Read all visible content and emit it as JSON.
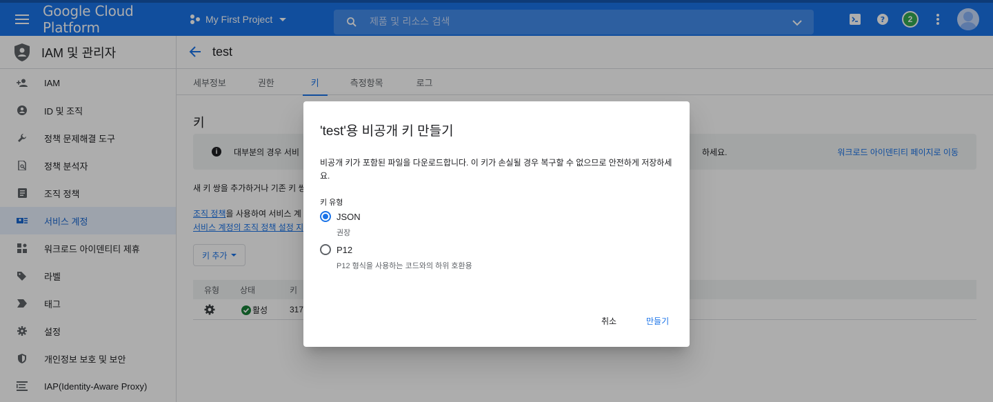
{
  "topbar": {
    "brand": "Google Cloud Platform",
    "project": "My First Project",
    "search_placeholder": "제품 및 리소스 검색",
    "notification_count": "2"
  },
  "sidebar": {
    "title": "IAM 및 관리자",
    "items": [
      {
        "label": "IAM",
        "icon": "person-add-icon"
      },
      {
        "label": "ID 및 조직",
        "icon": "account-circle-icon"
      },
      {
        "label": "정책 문제해결 도구",
        "icon": "wrench-icon"
      },
      {
        "label": "정책 분석자",
        "icon": "document-search-icon"
      },
      {
        "label": "조직 정책",
        "icon": "list-document-icon"
      },
      {
        "label": "서비스 계정",
        "icon": "service-account-icon",
        "active": true
      },
      {
        "label": "워크로드 아이덴티티 제휴",
        "icon": "workload-icon"
      },
      {
        "label": "라벨",
        "icon": "label-icon"
      },
      {
        "label": "태그",
        "icon": "tag-icon"
      },
      {
        "label": "설정",
        "icon": "gear-icon"
      },
      {
        "label": "개인정보 보호 및 보안",
        "icon": "shield-icon"
      },
      {
        "label": "IAP(Identity-Aware Proxy)",
        "icon": "proxy-icon"
      }
    ]
  },
  "main": {
    "title": "test",
    "tabs": [
      "세부정보",
      "권한",
      "키",
      "측정항목",
      "로그"
    ],
    "active_tab": "키",
    "section_title": "키",
    "info_text": "대부분의 경우 서비",
    "info_tail": "하세요.",
    "info_link": "워크로드 아이덴티티 페이지로 이동",
    "desc": "새 키 쌍을 추가하거나 기존 키 쌍",
    "desc2_link1": "조직 정책",
    "desc2_text": "을 사용하여 서비스 계",
    "desc2_link2": "서비스 계정의 조직 정책 설정 지",
    "add_key": "키 추가",
    "table": {
      "headers": [
        "유형",
        "상태",
        "키"
      ],
      "row": {
        "status": "활성",
        "key": "317"
      }
    }
  },
  "dialog": {
    "title": "'test'용 비공개 키 만들기",
    "body": "비공개 키가 포함된 파일을 다운로드합니다. 이 키가 손실될 경우 복구할 수 없으므로 안전하게 저장하세요.",
    "key_type_label": "키 유형",
    "options": [
      {
        "label": "JSON",
        "hint": "권장",
        "checked": true
      },
      {
        "label": "P12",
        "hint": "P12 형식을 사용하는 코드와의 하위 호환용",
        "checked": false
      }
    ],
    "cancel": "취소",
    "create": "만들기"
  },
  "colors": {
    "brand_blue": "#1a73e8",
    "active_bg": "#e8f0fe",
    "status_green": "#188038"
  }
}
